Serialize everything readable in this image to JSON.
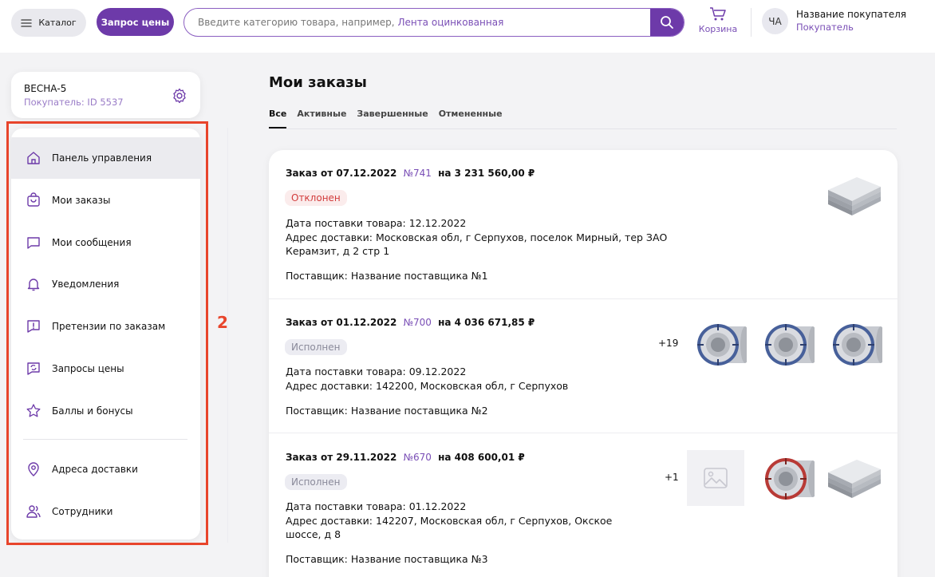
{
  "header": {
    "catalog_label": "Каталог",
    "price_request_label": "Запрос цены",
    "search_placeholder": "Введите категорию товара, например, ",
    "search_example": "Лента оцинкованная",
    "cart_label": "Корзина",
    "avatar_initials": "ЧА",
    "buyer_name": "Название покупателя",
    "buyer_role": "Покупатель"
  },
  "account": {
    "name": "ВЕСНА-5",
    "id_text": "Покупатель: ID 5537"
  },
  "sidebar": {
    "items": [
      {
        "label": "Панель управления",
        "icon": "home-icon",
        "active": true
      },
      {
        "label": "Мои заказы",
        "icon": "bag-icon"
      },
      {
        "label": "Мои сообщения",
        "icon": "message-icon"
      },
      {
        "label": "Уведомления",
        "icon": "bell-icon"
      },
      {
        "label": "Претензии по заказам",
        "icon": "claim-icon"
      },
      {
        "label": "Запросы цены",
        "icon": "price-request-icon"
      },
      {
        "label": "Баллы и бонусы",
        "icon": "star-icon"
      },
      {
        "label": "Адреса доставки",
        "icon": "location-pin-icon"
      },
      {
        "label": "Сотрудники",
        "icon": "users-icon"
      }
    ]
  },
  "annotation_label": "2",
  "main": {
    "title": "Мои заказы",
    "tabs": [
      "Все",
      "Активные",
      "Завершенные",
      "Отмененные"
    ],
    "orders": [
      {
        "title": "Заказ от 07.12.2022",
        "number": "№741",
        "sum": "на 3 231 560,00 ₽",
        "status": "Отклонен",
        "delivery_date": "Дата поставки товара: 12.12.2022",
        "address_line1": "Адрес доставки: Московская обл, г Серпухов, поселок Мирный, тер ЗАО",
        "address_line2": "Керамзит, д 2 стр 1",
        "supplier": "Поставщик: Название поставщика №1"
      },
      {
        "title": "Заказ от 01.12.2022",
        "number": "№700",
        "sum": "на 4 036 671,85 ₽",
        "status": "Исполнен",
        "more": "+19",
        "delivery_date": "Дата поставки товара: 09.12.2022",
        "address_line1": "Адрес доставки: 142200, Московская обл, г Серпухов",
        "supplier": "Поставщик: Название поставщика №2"
      },
      {
        "title": "Заказ от 29.11.2022",
        "number": "№670",
        "sum": "на 408 600,01 ₽",
        "status": "Исполнен",
        "more": "+1",
        "delivery_date": "Дата поставки товара: 01.12.2022",
        "address_line1": "Адрес доставки: 142207, Московская обл, г Серпухов, Окское",
        "address_line2": "шоссе, д 8",
        "supplier": "Поставщик: Название поставщика №3"
      }
    ]
  },
  "colors": {
    "accent": "#6d3aa9",
    "highlight": "#e8452c",
    "rejected": "#d23b3b"
  }
}
